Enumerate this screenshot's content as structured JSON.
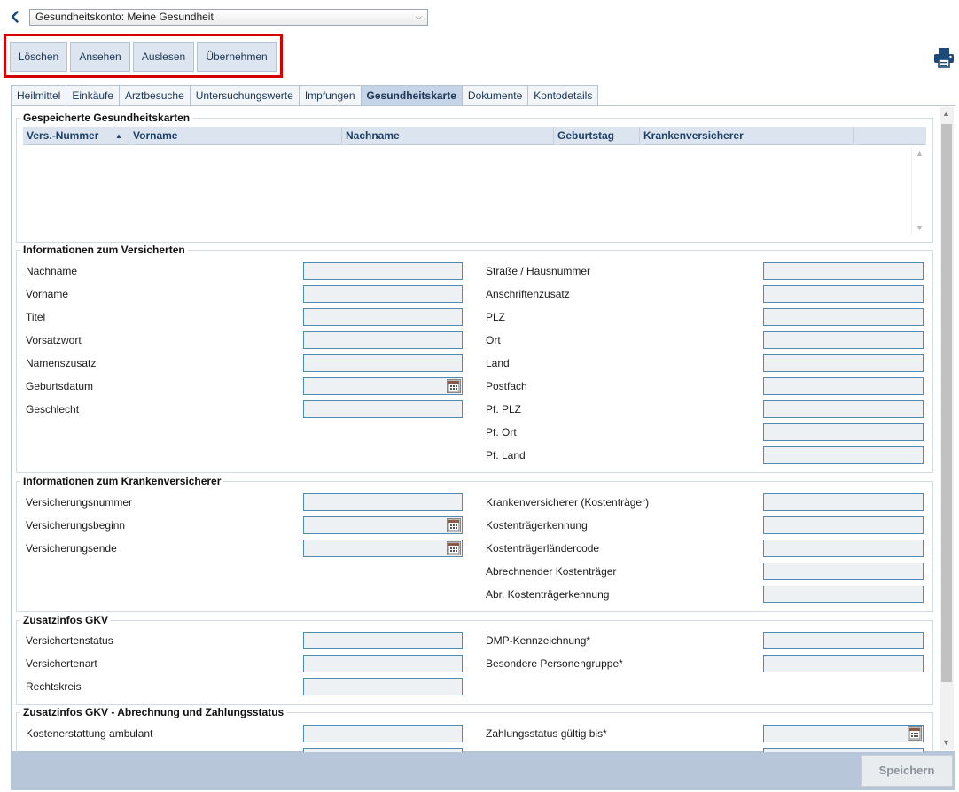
{
  "header": {
    "back_icon": "chevron-left-icon",
    "account_select": {
      "value": "Gesundheitskonto: Meine Gesundheit"
    }
  },
  "toolbar": {
    "buttons": [
      "Löschen",
      "Ansehen",
      "Auslesen",
      "Übernehmen"
    ],
    "print_icon": "printer-icon"
  },
  "tabs": {
    "items": [
      "Heilmittel",
      "Einkäufe",
      "Arztbesuche",
      "Untersuchungswerte",
      "Impfungen",
      "Gesundheitskarte",
      "Dokumente",
      "Kontodetails"
    ],
    "active": "Gesundheitskarte"
  },
  "cards": {
    "title": "Gespeicherte Gesundheitskarten",
    "columns": [
      "Vers.-Nummer",
      "Vorname",
      "Nachname",
      "Geburtstag",
      "Krankenversicherer"
    ],
    "sort_icon": "sort-ascending-icon",
    "rows": []
  },
  "insured": {
    "title": "Informationen zum Versicherten",
    "left_fields": [
      "Nachname",
      "Vorname",
      "Titel",
      "Vorsatzwort",
      "Namenszusatz",
      "Geburtsdatum",
      "Geschlecht"
    ],
    "right_fields": [
      "Straße / Hausnummer",
      "Anschriftenzusatz",
      "PLZ",
      "Ort",
      "Land",
      "Postfach",
      "Pf. PLZ",
      "Pf. Ort",
      "Pf. Land"
    ]
  },
  "insurer": {
    "title": "Informationen zum Krankenversicherer",
    "left_fields": [
      "Versicherungsnummer",
      "Versicherungsbeginn",
      "Versicherungsende"
    ],
    "right_fields": [
      "Krankenversicherer (Kostenträger)",
      "Kostenträgerkennung",
      "Kostenträgerländercode",
      "Abrechnender Kostenträger",
      "Abr. Kostenträgerkennung"
    ]
  },
  "gkv": {
    "title": "Zusatzinfos GKV",
    "left_fields": [
      "Versichertenstatus",
      "Versichertenart",
      "Rechtskreis"
    ],
    "right_fields": [
      "DMP-Kennzeichnung*",
      "Besondere Personengruppe*"
    ]
  },
  "billing": {
    "title": "Zusatzinfos GKV - Abrechnung und Zahlungsstatus",
    "left_fields": [
      "Kostenerstattung ambulant"
    ],
    "right_fields": [
      "Zahlungsstatus gültig bis*"
    ]
  },
  "footer": {
    "save_label": "Speichern"
  },
  "colors": {
    "accent": "#1e4a7a",
    "highlight_frame": "#d40000",
    "footer_bar": "#b7c6d9"
  }
}
